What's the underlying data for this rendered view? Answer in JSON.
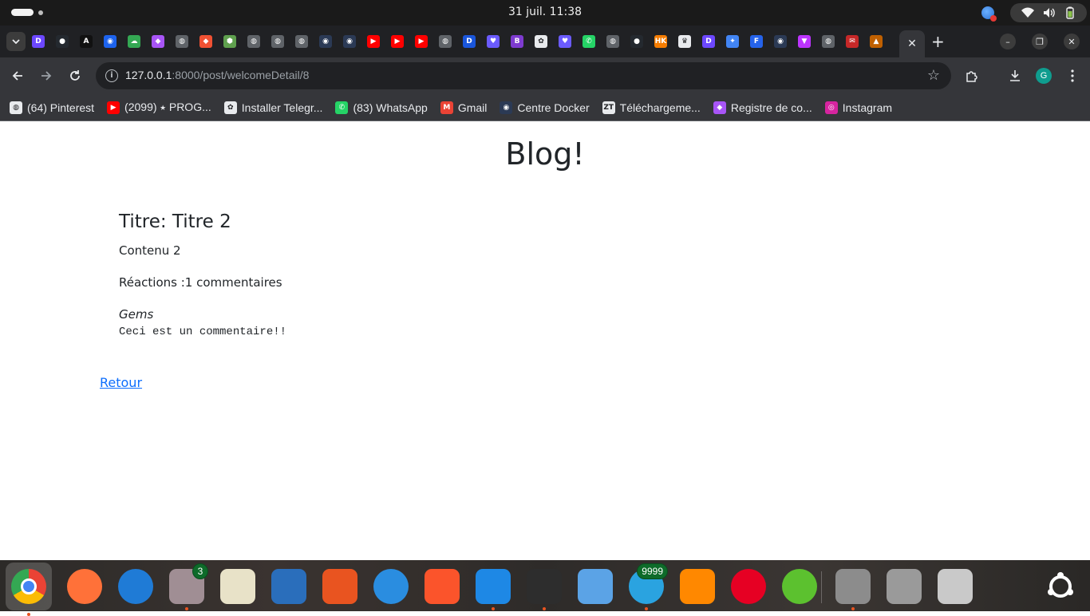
{
  "topbar": {
    "clock": "31 juil.  11:38"
  },
  "browser": {
    "pinned_tabs": [
      {
        "icon": "d-icon",
        "color": "#6c47ff",
        "glyph": "D"
      },
      {
        "icon": "github-icon",
        "color": "#24292f",
        "glyph": "●"
      },
      {
        "icon": "code-icon",
        "color": "#111111",
        "glyph": "A"
      },
      {
        "icon": "docker-icon",
        "color": "#1d63ed",
        "glyph": "◉"
      },
      {
        "icon": "cloud-icon",
        "color": "#34a853",
        "glyph": "☁"
      },
      {
        "icon": "cube-icon",
        "color": "#a855f7",
        "glyph": "◆"
      },
      {
        "icon": "globe-icon",
        "color": "#5f6368",
        "glyph": "◍"
      },
      {
        "icon": "git-icon",
        "color": "#f05133",
        "glyph": "◆"
      },
      {
        "icon": "node-icon",
        "color": "#5fa04e",
        "glyph": "⬢"
      },
      {
        "icon": "globe-icon",
        "color": "#5f6368",
        "glyph": "◍"
      },
      {
        "icon": "globe-icon",
        "color": "#5f6368",
        "glyph": "◍"
      },
      {
        "icon": "globe-icon",
        "color": "#5f6368",
        "glyph": "◍"
      },
      {
        "icon": "docker-icon",
        "color": "#2b3a55",
        "glyph": "◉"
      },
      {
        "icon": "docker-icon",
        "color": "#2b3a55",
        "glyph": "◉"
      },
      {
        "icon": "youtube-icon",
        "color": "#ff0000",
        "glyph": "▶"
      },
      {
        "icon": "youtube-icon",
        "color": "#ff0000",
        "glyph": "▶"
      },
      {
        "icon": "youtube-icon",
        "color": "#ff0000",
        "glyph": "▶"
      },
      {
        "icon": "globe-icon",
        "color": "#5f6368",
        "glyph": "◍"
      },
      {
        "icon": "d-icon",
        "color": "#1a56db",
        "glyph": "D"
      },
      {
        "icon": "heart-icon",
        "color": "#6b5bff",
        "glyph": "♥"
      },
      {
        "icon": "b-icon",
        "color": "#7e3bd0",
        "glyph": "B"
      },
      {
        "icon": "openai-icon",
        "color": "#e8eaed",
        "glyph": "✿"
      },
      {
        "icon": "heart-icon",
        "color": "#6b5bff",
        "glyph": "♥"
      },
      {
        "icon": "whatsapp-icon",
        "color": "#25d366",
        "glyph": "✆"
      },
      {
        "icon": "globe-icon",
        "color": "#5f6368",
        "glyph": "◍"
      },
      {
        "icon": "github-icon",
        "color": "#24292f",
        "glyph": "●"
      },
      {
        "icon": "hk-icon",
        "color": "#f57c00",
        "glyph": "HK"
      },
      {
        "icon": "crown-icon",
        "color": "#e8eaed",
        "glyph": "♛"
      },
      {
        "icon": "d-icon",
        "color": "#6c47ff",
        "glyph": "D"
      },
      {
        "icon": "sparkle-icon",
        "color": "#4285f4",
        "glyph": "✦"
      },
      {
        "icon": "f-icon",
        "color": "#2563eb",
        "glyph": "F"
      },
      {
        "icon": "docker-icon",
        "color": "#2b3a55",
        "glyph": "◉"
      },
      {
        "icon": "vite-icon",
        "color": "#bd34fe",
        "glyph": "▼"
      },
      {
        "icon": "globe-icon",
        "color": "#5f6368",
        "glyph": "◍"
      },
      {
        "icon": "mail-icon",
        "color": "#c62828",
        "glyph": "✉"
      },
      {
        "icon": "arch-icon",
        "color": "#c06000",
        "glyph": "▲"
      }
    ],
    "active_tab_close": "✕",
    "new_tab": "+",
    "window": {
      "minimize": "–",
      "maximize": "❐",
      "close": "✕"
    },
    "address": {
      "info": "i",
      "host": "127.0.0.1",
      "rest": ":8000/post/welcomeDetail/8"
    },
    "profile_initial": "G",
    "bookmarks": [
      {
        "label": "(64) Pinterest",
        "icon": "globe-icon",
        "color": "#e8eaed",
        "glyph": "◍"
      },
      {
        "label": "(2099) ⭑ PROG...",
        "icon": "youtube-icon",
        "color": "#ff0000",
        "glyph": "▶"
      },
      {
        "label": "Installer Telegr...",
        "icon": "openai-icon",
        "color": "#e8eaed",
        "glyph": "✿"
      },
      {
        "label": "(83) WhatsApp",
        "icon": "whatsapp-icon",
        "color": "#25d366",
        "glyph": "✆"
      },
      {
        "label": "Gmail",
        "icon": "gmail-icon",
        "color": "#ea4335",
        "glyph": "M"
      },
      {
        "label": "Centre Docker",
        "icon": "docker-icon",
        "color": "#2b3a55",
        "glyph": "◉"
      },
      {
        "label": "Téléchargeme...",
        "icon": "zt-icon",
        "color": "#e8eaed",
        "glyph": "ZT"
      },
      {
        "label": "Registre de co...",
        "icon": "cube-icon",
        "color": "#a855f7",
        "glyph": "◆"
      },
      {
        "label": "Instagram",
        "icon": "instagram-icon",
        "color": "#d6249f",
        "glyph": "◎"
      }
    ]
  },
  "page": {
    "heading": "Blog!",
    "post": {
      "title": "Titre: Titre 2",
      "content": "Contenu 2",
      "reactions": "Réactions :1 commentaires"
    },
    "comments": [
      {
        "author": "Gems",
        "text": "Ceci est un commentaire!!"
      }
    ],
    "back_link": "Retour"
  },
  "dock": {
    "apps": [
      {
        "name": "chrome-icon",
        "color": "#4285f4",
        "running": true,
        "active": true
      },
      {
        "name": "firefox-icon",
        "color": "#ff7139",
        "running": false
      },
      {
        "name": "thunderbird-icon",
        "color": "#1f7bd6",
        "running": false
      },
      {
        "name": "files-icon",
        "color": "#a08e94",
        "running": true,
        "badge": "3"
      },
      {
        "name": "rhythmbox-icon",
        "color": "#e8e2c8",
        "running": false
      },
      {
        "name": "writer-icon",
        "color": "#2a6ebb",
        "running": false
      },
      {
        "name": "app-center-icon",
        "color": "#e95420",
        "running": false
      },
      {
        "name": "help-icon",
        "color": "#2a8de0",
        "running": false
      },
      {
        "name": "brave-icon",
        "color": "#fb542b",
        "running": false
      },
      {
        "name": "vscode-icon",
        "color": "#1e88e5",
        "running": true
      },
      {
        "name": "terminal-icon",
        "color": "#2d2d2d",
        "running": true
      },
      {
        "name": "text-editor-icon",
        "color": "#5ba3e6",
        "running": false
      },
      {
        "name": "telegram-icon",
        "color": "#2aa3e0",
        "running": true,
        "badge": "9999"
      },
      {
        "name": "vlc-icon",
        "color": "#ff8800",
        "running": false
      },
      {
        "name": "pinterest-icon",
        "color": "#e60023",
        "running": false
      },
      {
        "name": "cloud-upload-icon",
        "color": "#5cc12f",
        "running": false
      },
      {
        "name": "settings-icon",
        "color": "#8c8c8c",
        "running": true
      },
      {
        "name": "disk-icon",
        "color": "#9a9a9a",
        "running": false
      },
      {
        "name": "trash-icon",
        "color": "#c9c9c9",
        "running": false
      }
    ],
    "show_apps": "ubuntu-logo-icon"
  }
}
